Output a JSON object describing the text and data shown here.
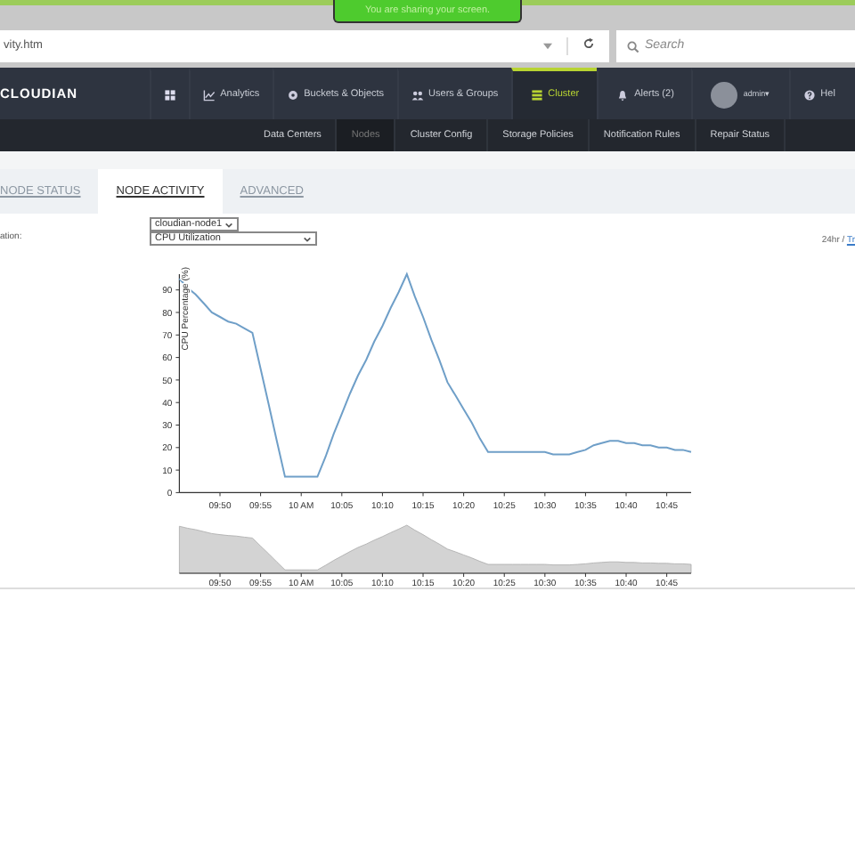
{
  "share_banner": {
    "text": "You are sharing your screen."
  },
  "browser": {
    "address": "vity.htm",
    "search_placeholder": "Search"
  },
  "brand": "CLOUDIAN",
  "nav": [
    {
      "kind": "grid",
      "selected": false
    },
    {
      "kind": "chart",
      "label": "Analytics",
      "selected": false
    },
    {
      "kind": "gear",
      "label": "Buckets & Objects",
      "selected": false
    },
    {
      "kind": "users",
      "label": "Users & Groups",
      "selected": false
    },
    {
      "kind": "cluster",
      "label": "Cluster",
      "selected": true
    },
    {
      "kind": "bell",
      "label": "Alerts (2)",
      "selected": false
    },
    {
      "kind": "avatar",
      "label": "admin▾",
      "selected": false
    },
    {
      "kind": "help",
      "label": "Hel",
      "selected": false
    }
  ],
  "subnav": [
    {
      "label": "Data Centers",
      "selected": false
    },
    {
      "label": "Nodes",
      "selected": true
    },
    {
      "label": "Cluster Config",
      "selected": false
    },
    {
      "label": "Storage Policies",
      "selected": false
    },
    {
      "label": "Notification Rules",
      "selected": false
    },
    {
      "label": "Repair Status",
      "selected": false
    }
  ],
  "tabs": [
    {
      "label": "NODE STATUS",
      "selected": false
    },
    {
      "label": "NODE ACTIVITY",
      "selected": true
    },
    {
      "label": "ADVANCED",
      "selected": false
    }
  ],
  "form": {
    "label": "ation:",
    "node_select": "cloudian-node1",
    "metric_select": "CPU Utilization",
    "range_text": "24hr /",
    "range_link": "Tr"
  },
  "chart": {
    "chart_data": {
      "type": "line",
      "ylabel": "CPU Percentage (%)",
      "categories": [
        null,
        null,
        null,
        null,
        null,
        "09:50",
        null,
        null,
        null,
        null,
        "09:55",
        null,
        null,
        null,
        null,
        "10 AM",
        null,
        null,
        null,
        null,
        "10:05",
        null,
        null,
        null,
        null,
        "10:10",
        null,
        null,
        null,
        null,
        "10:15",
        null,
        null,
        null,
        null,
        "10:20",
        null,
        null,
        null,
        null,
        "10:25",
        null,
        null,
        null,
        null,
        "10:30",
        null,
        null,
        null,
        null,
        "10:35",
        null,
        null,
        null,
        null,
        "10:40",
        null,
        null,
        null,
        null,
        "10:45",
        null,
        null,
        null
      ],
      "series": [
        {
          "color": "#6f9fc8",
          "values": [
            95,
            91,
            88,
            84,
            80,
            78,
            76,
            75,
            73,
            71,
            55,
            39,
            23,
            7,
            7,
            7,
            7,
            7,
            16,
            26,
            35,
            44,
            52,
            59,
            67,
            74,
            82,
            89,
            97,
            87,
            78,
            68,
            59,
            49,
            43,
            37,
            31,
            24,
            18,
            18,
            18,
            18,
            18,
            18,
            18,
            18,
            17,
            17,
            17,
            18,
            19,
            21,
            22,
            23,
            23,
            22,
            22,
            21,
            21,
            20,
            20,
            19,
            19,
            18
          ]
        }
      ],
      "ylim": [
        0,
        97
      ],
      "yticks": [
        0,
        10,
        20,
        30,
        40,
        50,
        60,
        70,
        80,
        90
      ]
    },
    "navigator_ticks": [
      "09:50",
      "09:55",
      "10 AM",
      "10:05",
      "10:10",
      "10:15",
      "10:20",
      "10:25",
      "10:30",
      "10:35",
      "10:40",
      "10:45"
    ]
  }
}
